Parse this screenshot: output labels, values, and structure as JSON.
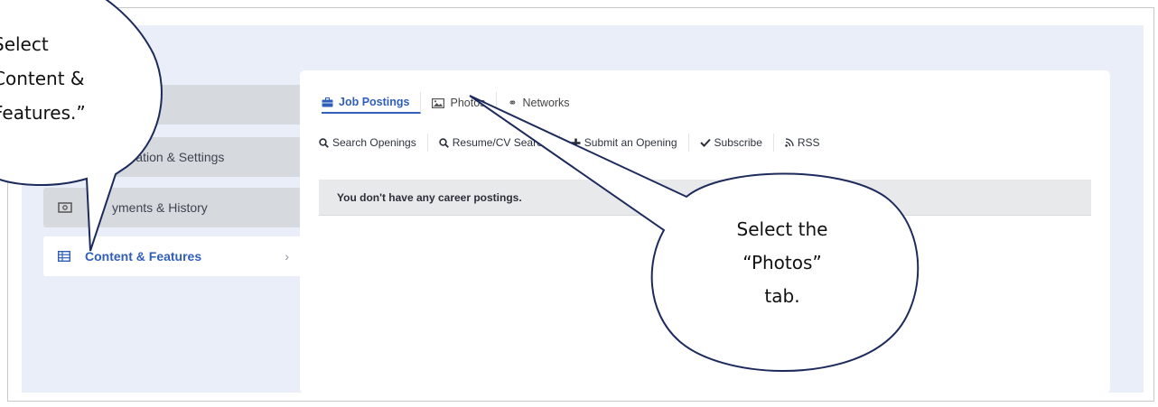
{
  "sidebar": {
    "items": [
      {
        "label": "",
        "icon": "blank"
      },
      {
        "label": "Information & Settings",
        "visible_label": "rmation & Settings",
        "icon": "info-icon"
      },
      {
        "label": "Payments & History",
        "visible_label": "yments & History",
        "icon": "cash-icon"
      },
      {
        "label": "Content & Features",
        "icon": "table-icon",
        "active": true
      }
    ]
  },
  "tabs": [
    {
      "label": "Job Postings",
      "icon": "briefcase-icon",
      "active": true
    },
    {
      "label": "Photos",
      "icon": "image-icon"
    },
    {
      "label": "Networks",
      "icon": "link-icon"
    }
  ],
  "actions": [
    {
      "label": "Search Openings",
      "icon": "search-icon"
    },
    {
      "label": "Resume/CV Search",
      "icon": "search-icon"
    },
    {
      "label": "Submit an Opening",
      "icon": "plus-icon"
    },
    {
      "label": "Subscribe",
      "icon": "check-icon"
    },
    {
      "label": "RSS",
      "icon": "rss-icon"
    }
  ],
  "notice": "You don't have any career postings.",
  "callouts": {
    "left": [
      "Select",
      "Content &",
      "Features.”"
    ],
    "right": [
      "Select the",
      "“Photos”",
      "tab."
    ]
  },
  "colors": {
    "accent": "#2f5fb8",
    "canvas": "#eaeef8",
    "callout_stroke": "#1d2b5c"
  }
}
